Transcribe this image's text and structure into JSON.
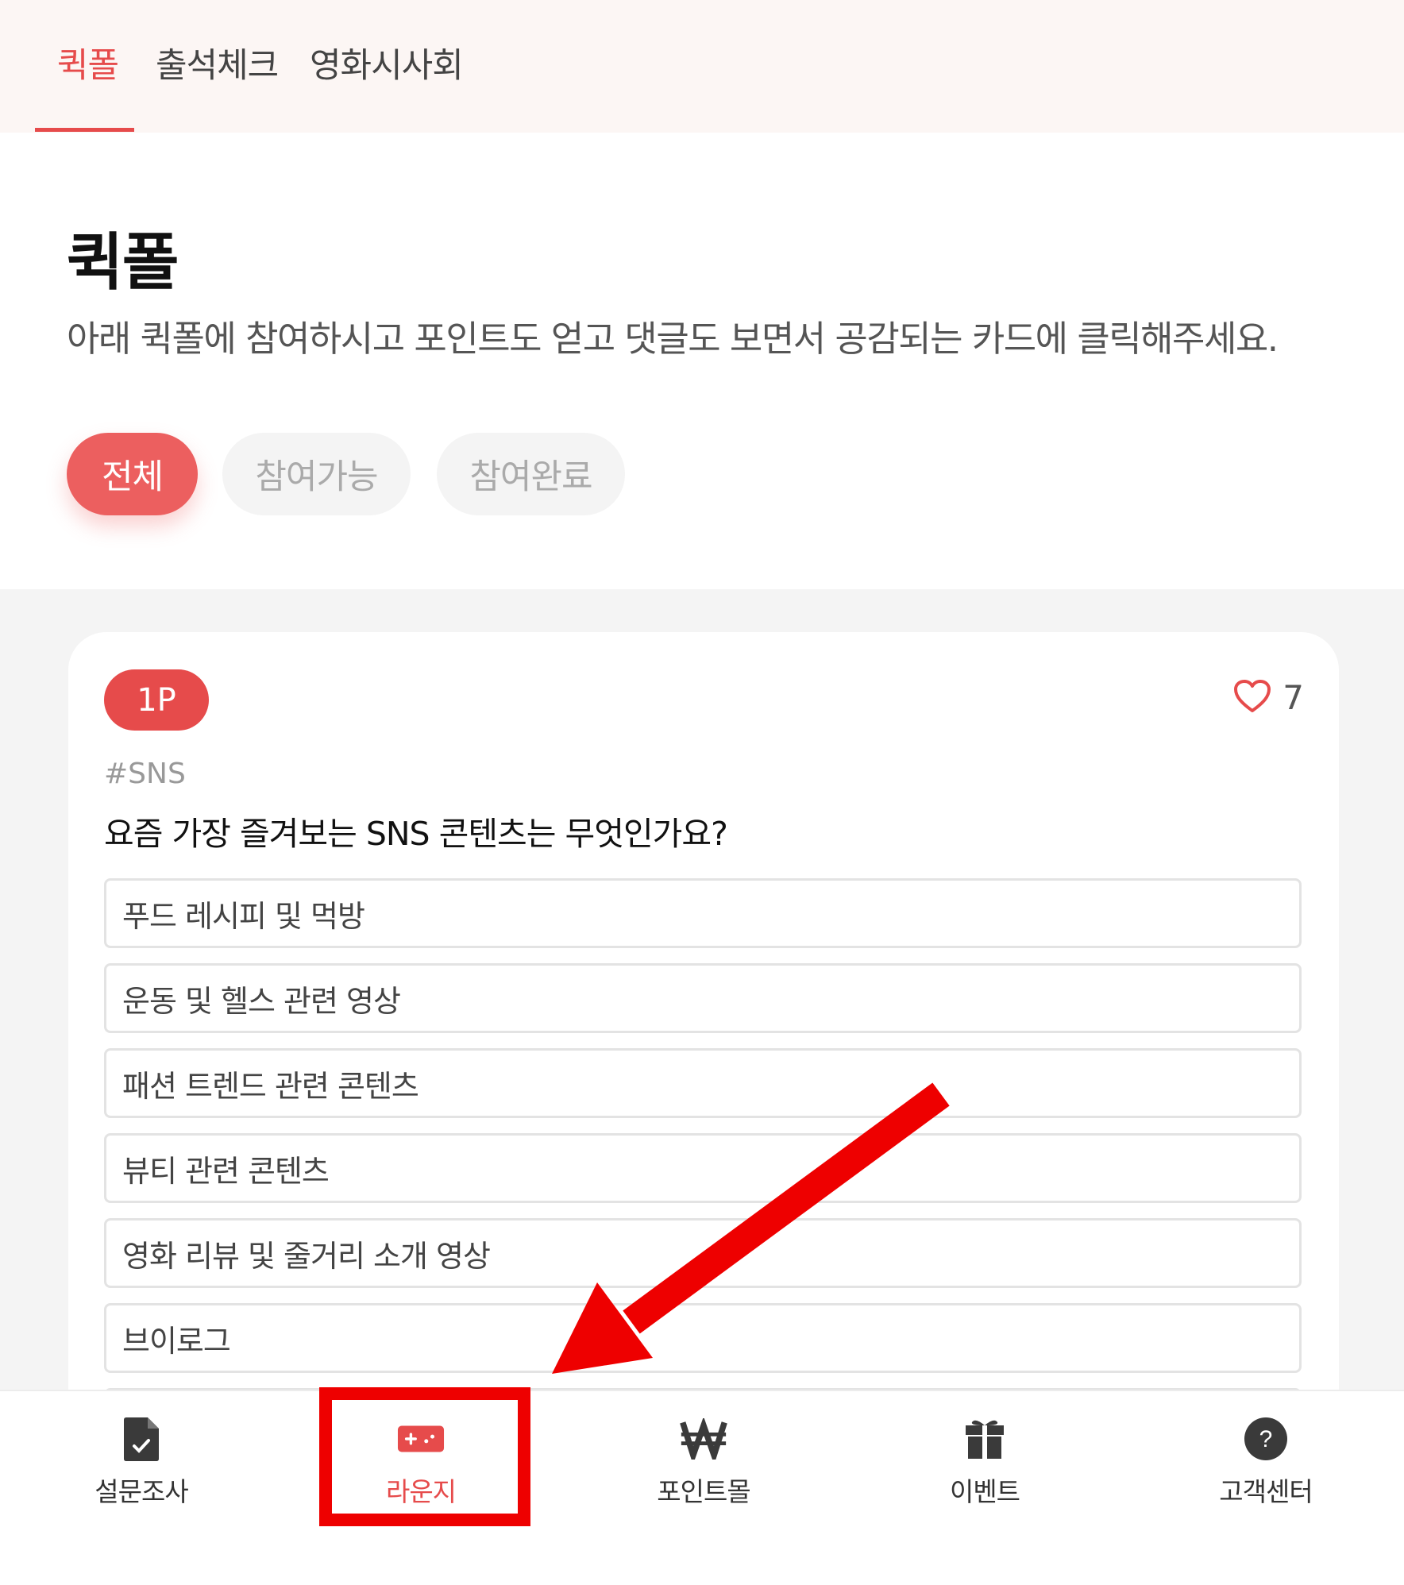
{
  "top_tabs": [
    {
      "label": "퀵폴",
      "active": true
    },
    {
      "label": "출석체크",
      "active": false
    },
    {
      "label": "영화시사회",
      "active": false
    }
  ],
  "page": {
    "title": "퀵폴",
    "description": "아래 퀵폴에 참여하시고 포인트도 얻고 댓글도 보면서 공감되는 카드에 클릭해주세요."
  },
  "filters": [
    {
      "label": "전체",
      "active": true
    },
    {
      "label": "참여가능",
      "active": false
    },
    {
      "label": "참여완료",
      "active": false
    }
  ],
  "card": {
    "points": "1P",
    "likes": "7",
    "tag": "#SNS",
    "question": "요즘 가장 즐겨보는 SNS 콘텐츠는 무엇인가요?",
    "options": [
      "푸드 레시피 및 먹방",
      "운동 및 헬스 관련 영상",
      "패션 트렌드 관련 콘텐츠",
      "뷰티 관련 콘텐츠",
      "영화 리뷰 및 줄거리 소개 영상",
      "브이로그"
    ]
  },
  "bottom_nav": [
    {
      "label": "설문조사",
      "icon": "survey-document-icon",
      "active": false
    },
    {
      "label": "라운지",
      "icon": "gamepad-icon",
      "active": true
    },
    {
      "label": "포인트몰",
      "icon": "won-currency-icon",
      "active": false
    },
    {
      "label": "이벤트",
      "icon": "gift-icon",
      "active": false
    },
    {
      "label": "고객센터",
      "icon": "help-question-icon",
      "active": false
    }
  ],
  "colors": {
    "accent": "#e64b4b",
    "annotation_red": "#ee0000",
    "top_bar_bg": "#fcf6f4",
    "content_bg": "#f4f4f4"
  }
}
